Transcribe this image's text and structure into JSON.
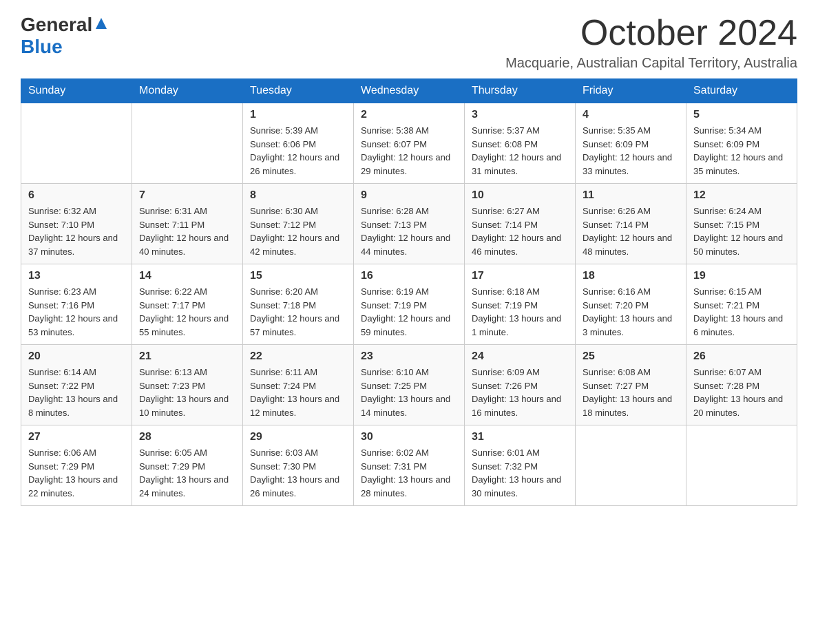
{
  "header": {
    "logo_general": "General",
    "logo_blue": "Blue",
    "month_title": "October 2024",
    "location": "Macquarie, Australian Capital Territory, Australia"
  },
  "weekdays": [
    "Sunday",
    "Monday",
    "Tuesday",
    "Wednesday",
    "Thursday",
    "Friday",
    "Saturday"
  ],
  "weeks": [
    [
      {
        "day": "",
        "sunrise": "",
        "sunset": "",
        "daylight": ""
      },
      {
        "day": "",
        "sunrise": "",
        "sunset": "",
        "daylight": ""
      },
      {
        "day": "1",
        "sunrise": "Sunrise: 5:39 AM",
        "sunset": "Sunset: 6:06 PM",
        "daylight": "Daylight: 12 hours and 26 minutes."
      },
      {
        "day": "2",
        "sunrise": "Sunrise: 5:38 AM",
        "sunset": "Sunset: 6:07 PM",
        "daylight": "Daylight: 12 hours and 29 minutes."
      },
      {
        "day": "3",
        "sunrise": "Sunrise: 5:37 AM",
        "sunset": "Sunset: 6:08 PM",
        "daylight": "Daylight: 12 hours and 31 minutes."
      },
      {
        "day": "4",
        "sunrise": "Sunrise: 5:35 AM",
        "sunset": "Sunset: 6:09 PM",
        "daylight": "Daylight: 12 hours and 33 minutes."
      },
      {
        "day": "5",
        "sunrise": "Sunrise: 5:34 AM",
        "sunset": "Sunset: 6:09 PM",
        "daylight": "Daylight: 12 hours and 35 minutes."
      }
    ],
    [
      {
        "day": "6",
        "sunrise": "Sunrise: 6:32 AM",
        "sunset": "Sunset: 7:10 PM",
        "daylight": "Daylight: 12 hours and 37 minutes."
      },
      {
        "day": "7",
        "sunrise": "Sunrise: 6:31 AM",
        "sunset": "Sunset: 7:11 PM",
        "daylight": "Daylight: 12 hours and 40 minutes."
      },
      {
        "day": "8",
        "sunrise": "Sunrise: 6:30 AM",
        "sunset": "Sunset: 7:12 PM",
        "daylight": "Daylight: 12 hours and 42 minutes."
      },
      {
        "day": "9",
        "sunrise": "Sunrise: 6:28 AM",
        "sunset": "Sunset: 7:13 PM",
        "daylight": "Daylight: 12 hours and 44 minutes."
      },
      {
        "day": "10",
        "sunrise": "Sunrise: 6:27 AM",
        "sunset": "Sunset: 7:14 PM",
        "daylight": "Daylight: 12 hours and 46 minutes."
      },
      {
        "day": "11",
        "sunrise": "Sunrise: 6:26 AM",
        "sunset": "Sunset: 7:14 PM",
        "daylight": "Daylight: 12 hours and 48 minutes."
      },
      {
        "day": "12",
        "sunrise": "Sunrise: 6:24 AM",
        "sunset": "Sunset: 7:15 PM",
        "daylight": "Daylight: 12 hours and 50 minutes."
      }
    ],
    [
      {
        "day": "13",
        "sunrise": "Sunrise: 6:23 AM",
        "sunset": "Sunset: 7:16 PM",
        "daylight": "Daylight: 12 hours and 53 minutes."
      },
      {
        "day": "14",
        "sunrise": "Sunrise: 6:22 AM",
        "sunset": "Sunset: 7:17 PM",
        "daylight": "Daylight: 12 hours and 55 minutes."
      },
      {
        "day": "15",
        "sunrise": "Sunrise: 6:20 AM",
        "sunset": "Sunset: 7:18 PM",
        "daylight": "Daylight: 12 hours and 57 minutes."
      },
      {
        "day": "16",
        "sunrise": "Sunrise: 6:19 AM",
        "sunset": "Sunset: 7:19 PM",
        "daylight": "Daylight: 12 hours and 59 minutes."
      },
      {
        "day": "17",
        "sunrise": "Sunrise: 6:18 AM",
        "sunset": "Sunset: 7:19 PM",
        "daylight": "Daylight: 13 hours and 1 minute."
      },
      {
        "day": "18",
        "sunrise": "Sunrise: 6:16 AM",
        "sunset": "Sunset: 7:20 PM",
        "daylight": "Daylight: 13 hours and 3 minutes."
      },
      {
        "day": "19",
        "sunrise": "Sunrise: 6:15 AM",
        "sunset": "Sunset: 7:21 PM",
        "daylight": "Daylight: 13 hours and 6 minutes."
      }
    ],
    [
      {
        "day": "20",
        "sunrise": "Sunrise: 6:14 AM",
        "sunset": "Sunset: 7:22 PM",
        "daylight": "Daylight: 13 hours and 8 minutes."
      },
      {
        "day": "21",
        "sunrise": "Sunrise: 6:13 AM",
        "sunset": "Sunset: 7:23 PM",
        "daylight": "Daylight: 13 hours and 10 minutes."
      },
      {
        "day": "22",
        "sunrise": "Sunrise: 6:11 AM",
        "sunset": "Sunset: 7:24 PM",
        "daylight": "Daylight: 13 hours and 12 minutes."
      },
      {
        "day": "23",
        "sunrise": "Sunrise: 6:10 AM",
        "sunset": "Sunset: 7:25 PM",
        "daylight": "Daylight: 13 hours and 14 minutes."
      },
      {
        "day": "24",
        "sunrise": "Sunrise: 6:09 AM",
        "sunset": "Sunset: 7:26 PM",
        "daylight": "Daylight: 13 hours and 16 minutes."
      },
      {
        "day": "25",
        "sunrise": "Sunrise: 6:08 AM",
        "sunset": "Sunset: 7:27 PM",
        "daylight": "Daylight: 13 hours and 18 minutes."
      },
      {
        "day": "26",
        "sunrise": "Sunrise: 6:07 AM",
        "sunset": "Sunset: 7:28 PM",
        "daylight": "Daylight: 13 hours and 20 minutes."
      }
    ],
    [
      {
        "day": "27",
        "sunrise": "Sunrise: 6:06 AM",
        "sunset": "Sunset: 7:29 PM",
        "daylight": "Daylight: 13 hours and 22 minutes."
      },
      {
        "day": "28",
        "sunrise": "Sunrise: 6:05 AM",
        "sunset": "Sunset: 7:29 PM",
        "daylight": "Daylight: 13 hours and 24 minutes."
      },
      {
        "day": "29",
        "sunrise": "Sunrise: 6:03 AM",
        "sunset": "Sunset: 7:30 PM",
        "daylight": "Daylight: 13 hours and 26 minutes."
      },
      {
        "day": "30",
        "sunrise": "Sunrise: 6:02 AM",
        "sunset": "Sunset: 7:31 PM",
        "daylight": "Daylight: 13 hours and 28 minutes."
      },
      {
        "day": "31",
        "sunrise": "Sunrise: 6:01 AM",
        "sunset": "Sunset: 7:32 PM",
        "daylight": "Daylight: 13 hours and 30 minutes."
      },
      {
        "day": "",
        "sunrise": "",
        "sunset": "",
        "daylight": ""
      },
      {
        "day": "",
        "sunrise": "",
        "sunset": "",
        "daylight": ""
      }
    ]
  ],
  "colors": {
    "header_bg": "#1a6fc4",
    "header_text": "#ffffff",
    "border": "#cccccc",
    "text_primary": "#333333",
    "logo_blue": "#1a6fc4"
  }
}
